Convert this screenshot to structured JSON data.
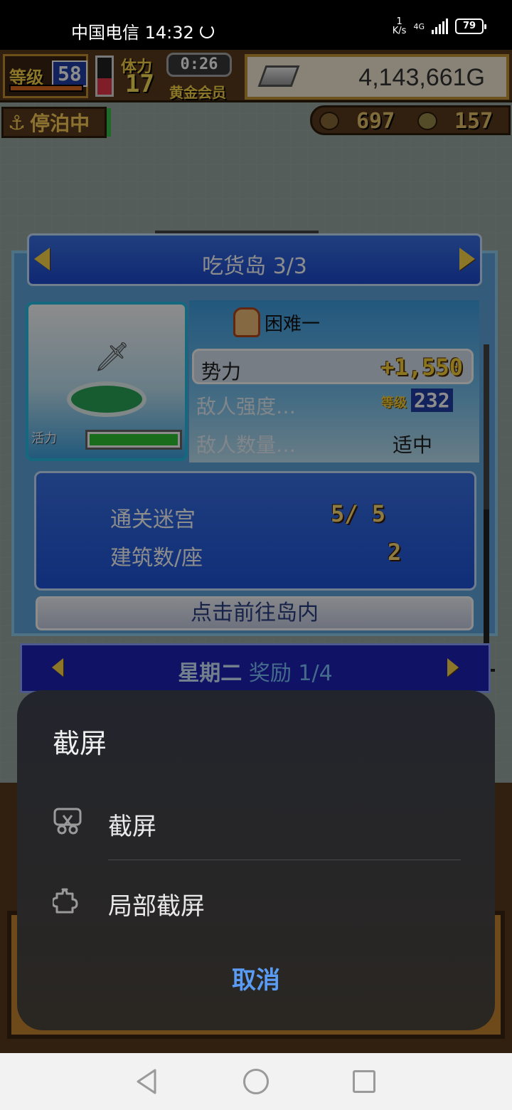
{
  "status_bar": {
    "carrier_time": "中国电信 14:32",
    "net_speed_value": "1",
    "net_speed_unit": "K/s",
    "network_type": "4G",
    "battery": "79"
  },
  "hud": {
    "level_label": "等级",
    "level_value": "58",
    "stamina_label": "体力",
    "stamina_value": "17",
    "stamina_fill_fraction": 0.45,
    "timer": "0:26",
    "membership": "黄金会员",
    "gold": "4,143,661G",
    "docked_status": "停泊中",
    "resource1": "697",
    "resource2": "157"
  },
  "island_panel": {
    "title": "吃货岛 3/3",
    "difficulty": "困难一",
    "vitality_label": "活力",
    "vitality_fraction": 1.0,
    "power_label": "势力",
    "power_value": "+1,550",
    "enemy_strength_label": "敌人强度…",
    "enemy_level_tag": "等级",
    "enemy_level_value": "232",
    "enemy_count_label": "敌人数量…",
    "enemy_count_value": "适中",
    "stats": [
      {
        "label": "通关迷宫",
        "value": "5/ 5"
      },
      {
        "label": "建筑数/座",
        "value": "2"
      }
    ],
    "go_button": "点击前往岛内"
  },
  "reward_bar": {
    "day": "星期二",
    "reward_label": "奖励 1/4"
  },
  "screenshot_sheet": {
    "title": "截屏",
    "options": [
      {
        "label": "截屏",
        "icon": "scissors-screenshot-icon"
      },
      {
        "label": "局部截屏",
        "icon": "puzzle-partial-screenshot-icon"
      }
    ],
    "cancel": "取消"
  },
  "colors": {
    "accent_blue": "#5a9cf5",
    "sheet_bg": "#25262b",
    "panel_blue": "#3a72e6"
  }
}
